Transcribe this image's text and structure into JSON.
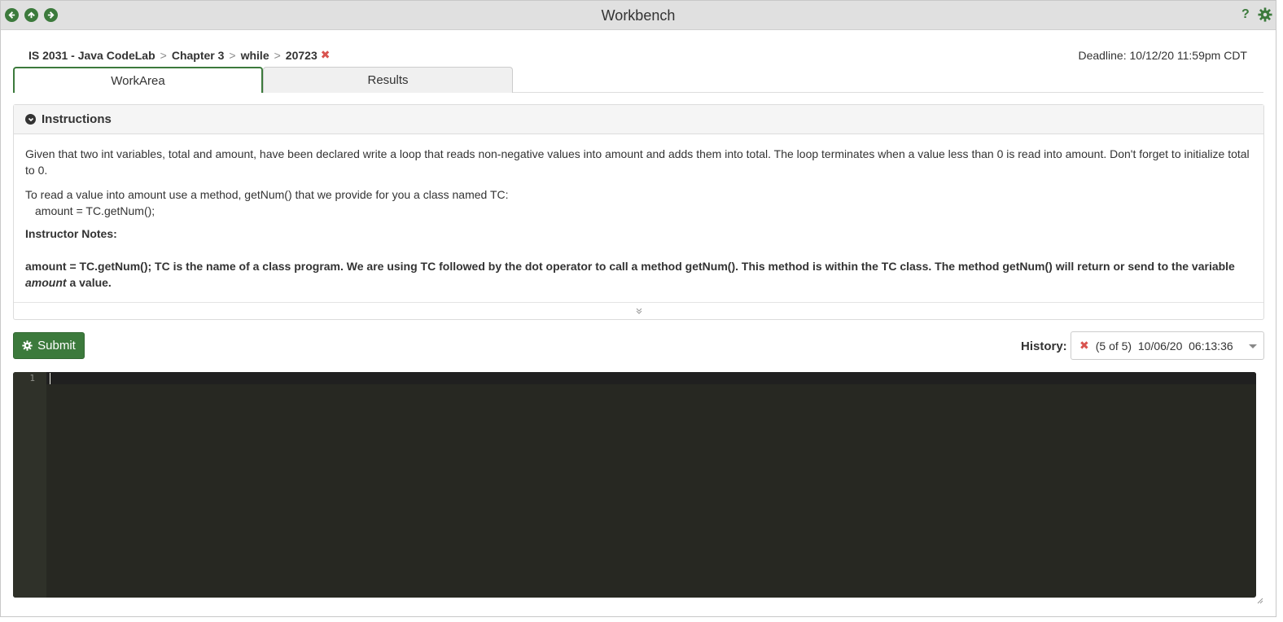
{
  "window": {
    "title": "Workbench"
  },
  "breadcrumb": {
    "items": [
      "IS 2031 - Java CodeLab",
      "Chapter 3",
      "while",
      "20723"
    ],
    "separator": ">"
  },
  "deadline": "Deadline: 10/12/20 11:59pm CDT",
  "tabs": [
    {
      "label": "WorkArea",
      "active": true
    },
    {
      "label": "Results",
      "active": false
    }
  ],
  "instructions": {
    "header": "Instructions",
    "para1": "Given that two int variables, total and amount, have been declared write a loop that reads non-negative values into amount and adds them into total. The loop terminates when a value less than 0 is read into amount. Don't forget to initialize total to 0.",
    "para2_line1": "To read a value into amount use a method, getNum() that we provide for you a class named TC:",
    "para2_line2": "amount = TC.getNum();",
    "notes_label": "Instructor Notes:",
    "notes_part1": "amount = TC.getNum(); TC is the name of a class program. We are using TC followed by the dot operator to call a method getNum(). This method is within the TC class. The method getNum() will return or send to the variable ",
    "notes_italic": "amount",
    "notes_part2": " a value."
  },
  "submit": {
    "label": "Submit"
  },
  "history": {
    "label": "History:",
    "selected": "(5 of 5)  10/06/20  06:13:36"
  },
  "editor": {
    "line_numbers": [
      "1"
    ]
  },
  "colors": {
    "accent": "#3c7a3c",
    "error": "#d9534f",
    "editor_bg": "#272822"
  }
}
